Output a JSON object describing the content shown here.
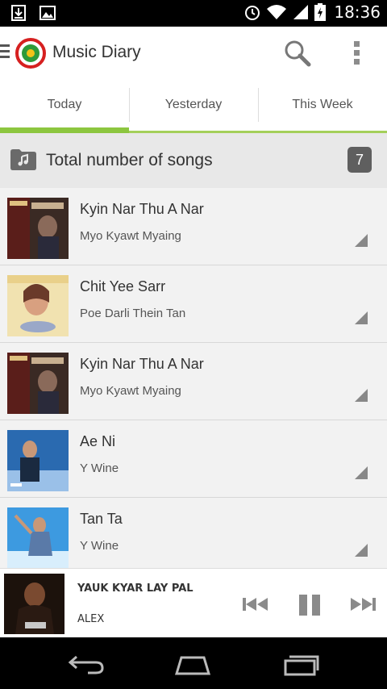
{
  "status_bar": {
    "time": "18:36",
    "left_icons": [
      "download-icon",
      "image-icon"
    ],
    "right_icons": [
      "alarm-icon",
      "wifi-icon",
      "signal-icon",
      "battery-charging-icon"
    ]
  },
  "action_bar": {
    "title": "Music Diary",
    "icons": [
      "menu-icon",
      "app-logo",
      "search-icon",
      "overflow-icon"
    ]
  },
  "tabs": [
    {
      "label": "Today",
      "active": true
    },
    {
      "label": "Yesterday",
      "active": false
    },
    {
      "label": "This Week",
      "active": false
    }
  ],
  "summary": {
    "label": "Total number of songs",
    "count": "7",
    "icon": "music-folder-icon"
  },
  "songs": [
    {
      "title": "Kyin Nar Thu A Nar",
      "artist": "Myo Kyawt Myaing"
    },
    {
      "title": "Chit Yee Sarr",
      "artist": "Poe Darli Thein Tan"
    },
    {
      "title": "Kyin Nar Thu A Nar",
      "artist": "Myo Kyawt Myaing"
    },
    {
      "title": "Ae Ni",
      "artist": "Y Wine"
    },
    {
      "title": "Tan Ta",
      "artist": "Y Wine"
    }
  ],
  "now_playing": {
    "title": "YAUK KYAR LAY PAL",
    "artist": "ALEX",
    "controls": [
      "previous-icon",
      "pause-icon",
      "next-icon"
    ]
  },
  "nav_bar": {
    "buttons": [
      "back-icon",
      "home-icon",
      "recent-apps-icon"
    ]
  },
  "colors": {
    "tab_indicator": "#8cc63f",
    "badge": "#5f5f5f",
    "summary_bg": "#e8e8e8",
    "list_bg": "#f2f2f2"
  }
}
